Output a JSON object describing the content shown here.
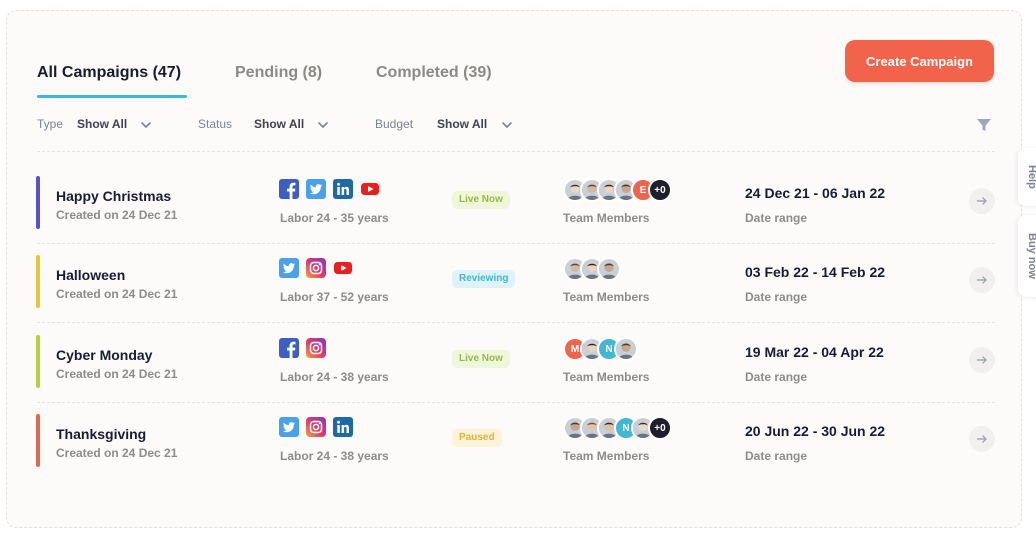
{
  "tabs": [
    {
      "label": "All Campaigns (47)",
      "active": true
    },
    {
      "label": "Pending (8)",
      "active": false
    },
    {
      "label": "Completed (39)",
      "active": false
    }
  ],
  "create_button": {
    "label": "Create Campaign"
  },
  "filters": [
    {
      "label": "Type",
      "value": "Show All"
    },
    {
      "label": "Status",
      "value": "Show All"
    },
    {
      "label": "Budget",
      "value": "Show All"
    }
  ],
  "side_tabs": {
    "help": "Help",
    "buy_now": "Buy now"
  },
  "campaigns": [
    {
      "title": "Happy Christmas",
      "created": "Created on 24 Dec 21",
      "accent": "#5a4fcf",
      "socials": [
        "facebook",
        "twitter",
        "linkedin",
        "youtube"
      ],
      "audience": "Labor 24 - 35 years",
      "status": "Live Now",
      "status_kind": "live",
      "team_label": "Team Members",
      "date_range": "24 Dec 21 - 06 Jan 22",
      "date_label": "Date range"
    },
    {
      "title": "Halloween",
      "created": "Created on 24 Dec 21",
      "accent": "#e8c53a",
      "socials": [
        "twitter",
        "instagram",
        "youtube"
      ],
      "audience": "Labor 37 - 52 years",
      "status": "Reviewing",
      "status_kind": "reviewing",
      "team_label": "Team Members",
      "date_range": "03 Feb 22 - 14 Feb 22",
      "date_label": "Date range"
    },
    {
      "title": "Cyber Monday",
      "created": "Created on 24 Dec 21",
      "accent": "#b8d13a",
      "socials": [
        "facebook",
        "instagram"
      ],
      "audience": "Labor 24 - 38 years",
      "status": "Live Now",
      "status_kind": "live",
      "team_label": "Team Members",
      "date_range": "19 Mar 22 - 04 Apr 22",
      "date_label": "Date range"
    },
    {
      "title": "Thanksgiving",
      "created": "Created on 24 Dec 21",
      "accent": "#e8664f",
      "socials": [
        "twitter",
        "instagram",
        "linkedin"
      ],
      "audience": "Labor 24 - 38 years",
      "status": "Paused",
      "status_kind": "paused",
      "team_label": "Team Members",
      "date_range": "20 Jun 22 - 30 Jun 22",
      "date_label": "Date range"
    }
  ],
  "avatar_sets": [
    [
      "photo",
      "photo",
      "photo",
      "photo",
      "E",
      "+0"
    ],
    [
      "photo",
      "photo",
      "photo"
    ],
    [
      "M",
      "photo",
      "N",
      "photo"
    ],
    [
      "photo",
      "photo",
      "photo",
      "N",
      "photo",
      "+0"
    ]
  ],
  "colors": {
    "accent_orange": "#f1634b",
    "tab_underline": "#40b8d4",
    "live_bg": "#eef7d9",
    "live_fg": "#9ab848",
    "reviewing_bg": "#ddf3f9",
    "reviewing_fg": "#45b5d3",
    "paused_bg": "#fdf3d8",
    "paused_fg": "#e0b53a"
  }
}
